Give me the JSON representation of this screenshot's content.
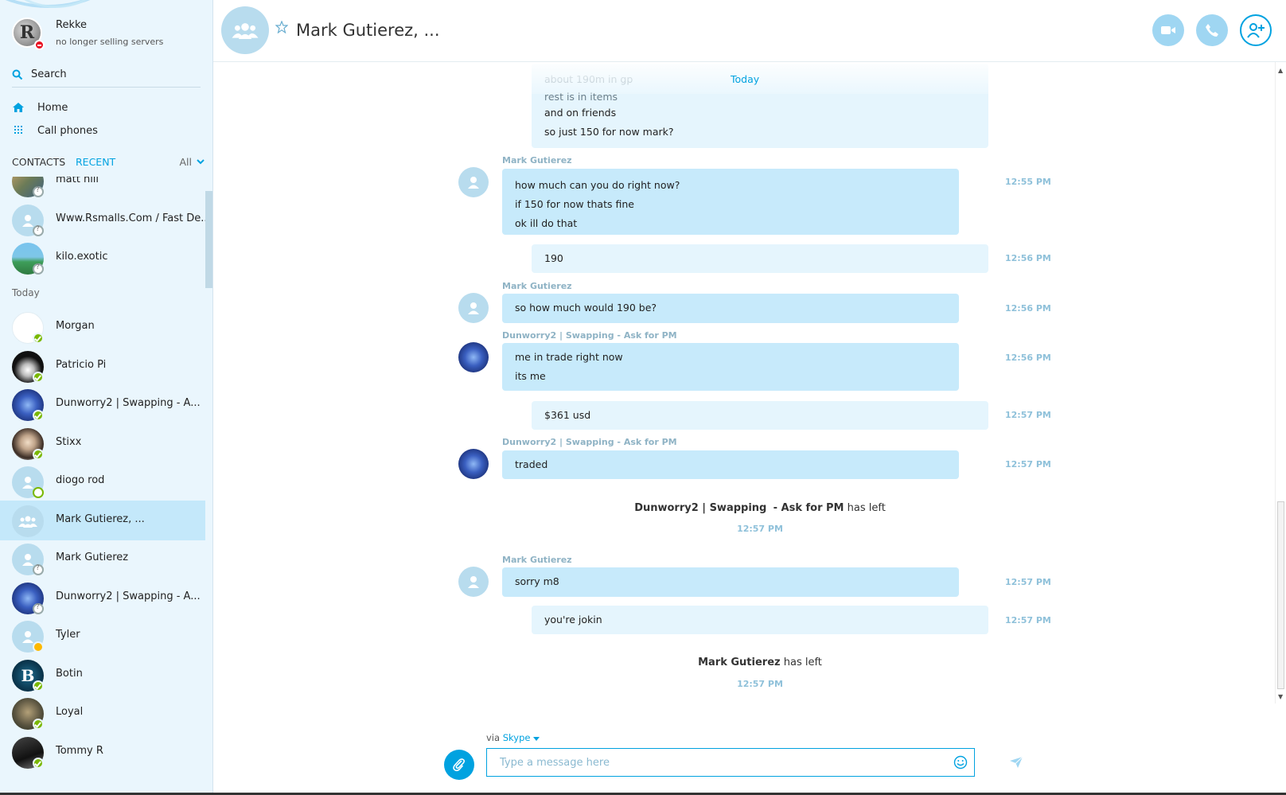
{
  "profile": {
    "name": "Rekke",
    "status": "no longer selling servers",
    "avatar_letter": "R"
  },
  "search": {
    "label": "Search"
  },
  "nav": {
    "home": "Home",
    "call_phones": "Call phones"
  },
  "tabs": {
    "contacts": "CONTACTS",
    "recent": "RECENT",
    "filter": "All"
  },
  "contacts_top": [
    {
      "name": "matt hill",
      "presence": "unknown"
    },
    {
      "name": "Www.Rsmalls.Com / Fast De...",
      "presence": "unknown"
    },
    {
      "name": "kilo.exotic",
      "presence": "unknown"
    }
  ],
  "section_today": "Today",
  "contacts_today": [
    {
      "name": "Morgan",
      "presence": "online"
    },
    {
      "name": "Patricio Pi",
      "presence": "online"
    },
    {
      "name": "Dunworry2 | Swapping    - A...",
      "presence": "online"
    },
    {
      "name": "Stixx",
      "presence": "online"
    },
    {
      "name": "diogo rod",
      "presence": "offline"
    },
    {
      "name": "Mark Gutierez, ...",
      "presence": "group",
      "active": true
    },
    {
      "name": "Mark Gutierez",
      "presence": "unknown"
    },
    {
      "name": "Dunworry2 | Swapping    - A...",
      "presence": "unknown"
    },
    {
      "name": "Tyler",
      "presence": "away"
    },
    {
      "name": "Botin",
      "presence": "online",
      "avatar_letter": "B"
    },
    {
      "name": "Loyal",
      "presence": "online"
    },
    {
      "name": "Tommy R",
      "presence": "online"
    }
  ],
  "conversation": {
    "title": "Mark Gutierez, ...",
    "day_label": "Today",
    "faded_lines": [
      "about 190m in gp",
      "rest is in items"
    ],
    "messages": [
      {
        "kind": "out",
        "lines": [
          "and on friends",
          "so just 150 for now mark?"
        ]
      },
      {
        "kind": "in",
        "sender": "Mark Gutierez",
        "time": "12:55 PM",
        "lines": [
          "how much can you do right now?",
          "if 150 for now thats fine",
          "ok ill do that"
        ]
      },
      {
        "kind": "out",
        "time": "12:56 PM",
        "lines": [
          "190"
        ]
      },
      {
        "kind": "in",
        "sender": "Mark Gutierez",
        "time": "12:56 PM",
        "lines": [
          "so how much would 190 be?"
        ]
      },
      {
        "kind": "in",
        "sender": "Dunworry2 | Swapping   - Ask for PM",
        "time": "12:56 PM",
        "lines": [
          "me in trade right now",
          "its me"
        ]
      },
      {
        "kind": "out",
        "time": "12:57 PM",
        "lines": [
          "$361 usd"
        ]
      },
      {
        "kind": "in",
        "sender": "Dunworry2 | Swapping   - Ask for PM",
        "time": "12:57 PM",
        "lines": [
          "traded"
        ]
      },
      {
        "kind": "in",
        "sender": "Mark Gutierez",
        "time": "12:57 PM",
        "lines": [
          "sorry m8"
        ]
      },
      {
        "kind": "out",
        "time": "12:57 PM",
        "lines": [
          "you're jokin"
        ]
      }
    ],
    "system_events": [
      {
        "name_a": "Dunworry2 | Swapping",
        "name_b": "- Ask for PM",
        "text": "has left",
        "time": "12:57 PM"
      },
      {
        "name_a": "Mark Gutierez",
        "name_b": "",
        "text": "has left",
        "time": "12:57 PM"
      }
    ]
  },
  "composer": {
    "via_label": "via",
    "via_service": "Skype",
    "placeholder": "Type a message here"
  },
  "colors": {
    "accent": "#00a2e0",
    "sidebar_bg": "#eaf6fd",
    "bubble_in": "#c7eafb",
    "bubble_out": "#e5f5fd",
    "online": "#7ab800",
    "dnd": "#e81123"
  }
}
